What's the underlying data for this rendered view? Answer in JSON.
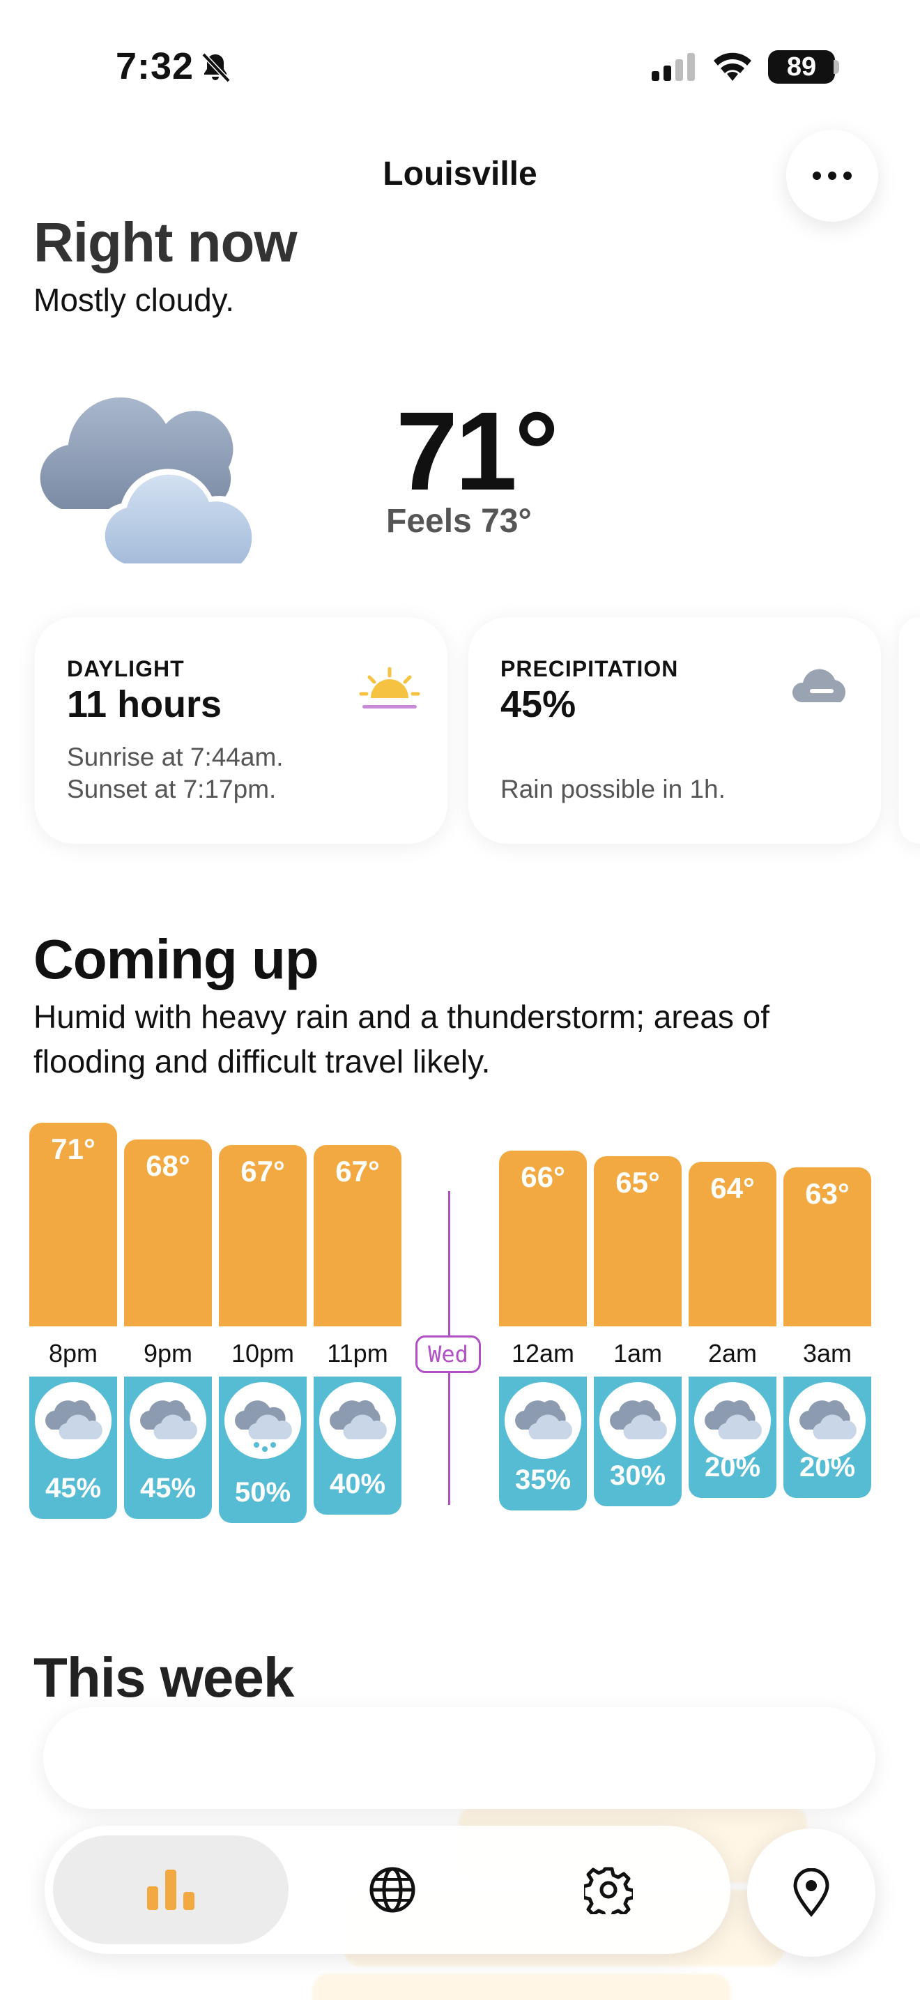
{
  "status_bar": {
    "time": "7:32",
    "battery": "89",
    "icons": [
      "bell-slash-icon",
      "signal-icon",
      "wifi-icon",
      "battery-icon"
    ]
  },
  "header": {
    "location": "Louisville",
    "more_icon": "ellipsis-icon"
  },
  "right_now": {
    "title": "Right now",
    "condition": "Mostly cloudy.",
    "icon": "cloudy-icon",
    "temperature": "71°",
    "feels_like": "Feels 73°"
  },
  "cards": {
    "daylight": {
      "label": "DAYLIGHT",
      "value": "11 hours",
      "sunrise": "Sunrise at 7:44am.",
      "sunset": "Sunset at 7:17pm.",
      "icon": "sunrise-icon"
    },
    "precipitation": {
      "label": "PRECIPITATION",
      "value": "45%",
      "detail": "Rain possible in 1h.",
      "icon": "cloud-icon"
    }
  },
  "coming_up": {
    "title": "Coming up",
    "summary": "Humid with heavy rain and a thunderstorm; areas of flooding and difficult travel likely."
  },
  "hourly": {
    "day_marker": "Wed",
    "hours": [
      {
        "time": "8pm",
        "temp": "71°",
        "temp_value": 71,
        "precip": "45%",
        "precip_value": 45,
        "icon": "partly-cloudy-night-icon"
      },
      {
        "time": "9pm",
        "temp": "68°",
        "temp_value": 68,
        "precip": "45%",
        "precip_value": 45,
        "icon": "partly-cloudy-night-icon"
      },
      {
        "time": "10pm",
        "temp": "67°",
        "temp_value": 67,
        "precip": "50%",
        "precip_value": 50,
        "icon": "rain-icon"
      },
      {
        "time": "11pm",
        "temp": "67°",
        "temp_value": 67,
        "precip": "40%",
        "precip_value": 40,
        "icon": "partly-cloudy-night-icon"
      },
      {
        "time": "12am",
        "temp": "66°",
        "temp_value": 66,
        "precip": "35%",
        "precip_value": 35,
        "icon": "partly-cloudy-night-icon"
      },
      {
        "time": "1am",
        "temp": "65°",
        "temp_value": 65,
        "precip": "30%",
        "precip_value": 30,
        "icon": "partly-cloudy-night-icon"
      },
      {
        "time": "2am",
        "temp": "64°",
        "temp_value": 64,
        "precip": "20%",
        "precip_value": 20,
        "icon": "partly-cloudy-night-icon"
      },
      {
        "time": "3am",
        "temp": "63°",
        "temp_value": 63,
        "precip": "20%",
        "precip_value": 20,
        "icon": "partly-cloudy-night-icon"
      }
    ]
  },
  "this_week": {
    "title": "This week"
  },
  "tab_bar": {
    "tabs": [
      {
        "icon": "bar-chart-icon",
        "active": true
      },
      {
        "icon": "globe-icon",
        "active": false
      },
      {
        "icon": "gear-icon",
        "active": false
      }
    ],
    "location_icon": "location-pin-icon"
  },
  "colors": {
    "temp_bar": "#f2a942",
    "precip_bar": "#56bcd3",
    "day_divider": "#b14fc5",
    "accent": "#f2a942"
  }
}
